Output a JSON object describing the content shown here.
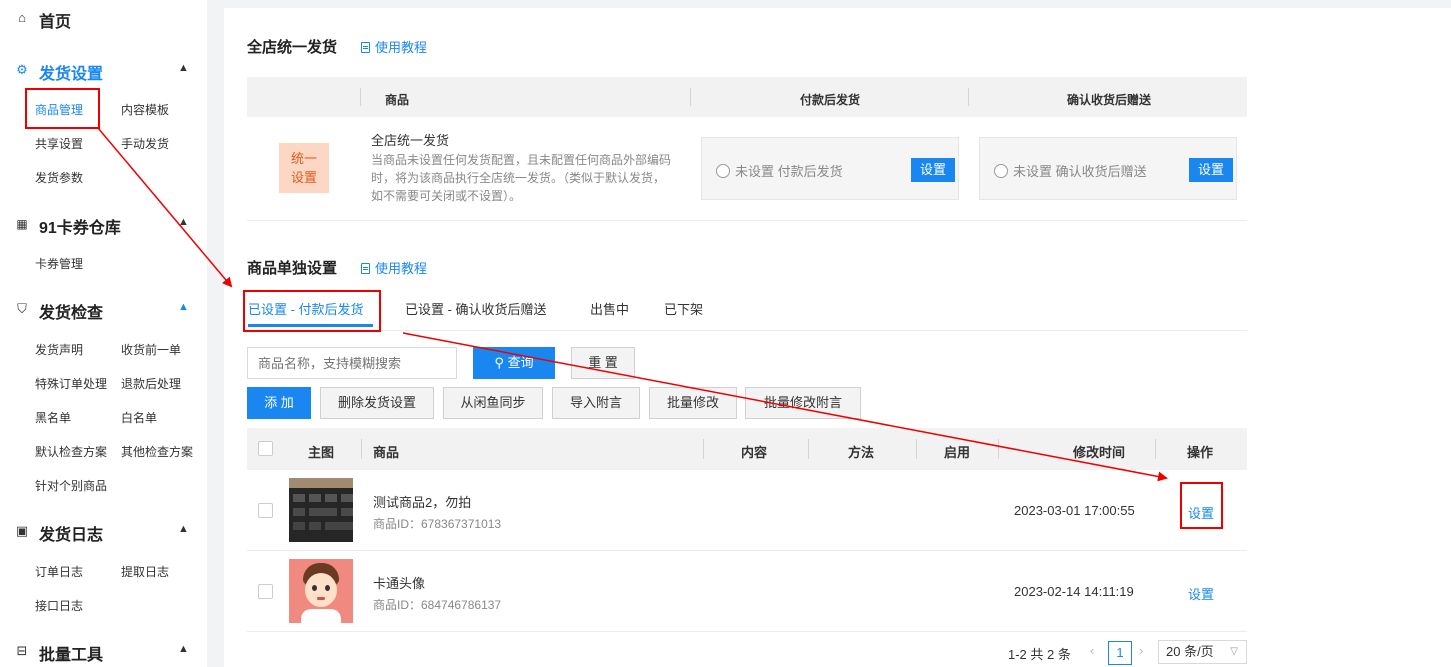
{
  "sidebar": {
    "home": "首页",
    "delivery_settings": {
      "title": "发货设置",
      "items": [
        "商品管理",
        "内容模板",
        "共享设置",
        "手动发货",
        "发货参数"
      ]
    },
    "coupon_store": {
      "title": "91卡券仓库",
      "items": [
        "卡券管理"
      ]
    },
    "delivery_check": {
      "title": "发货检查",
      "items": [
        "发货声明",
        "收货前一单",
        "特殊订单处理",
        "退款后处理",
        "黑名单",
        "白名单",
        "默认检查方案",
        "其他检查方案",
        "针对个别商品"
      ]
    },
    "delivery_log": {
      "title": "发货日志",
      "items": [
        "订单日志",
        "提取日志",
        "接口日志"
      ]
    },
    "batch_tools": {
      "title": "批量工具"
    }
  },
  "store": {
    "title": "全店统一发货",
    "tutorial": "使用教程",
    "headers": [
      "商品",
      "付款后发货",
      "确认收货后赠送"
    ],
    "badge": "统一设置",
    "name": "全店统一发货",
    "desc": "当商品未设置任何发货配置，且未配置任何商品外部编码时，将为该商品执行全店统一发货。（类似于默认发货，如不需要可关闭或不设置）。",
    "pay_option": "未设置 付款后发货",
    "confirm_option": "未设置 确认收货后赠送",
    "set_btn": "设置"
  },
  "single": {
    "title": "商品单独设置",
    "tutorial": "使用教程",
    "tabs": [
      "已设置 - 付款后发货",
      "已设置 - 确认收货后赠送",
      "出售中",
      "已下架"
    ],
    "search_placeholder": "商品名称，支持模糊搜索",
    "query": "查询",
    "reset": "重 置",
    "actions": [
      "添 加",
      "删除发货设置",
      "从闲鱼同步",
      "导入附言",
      "批量修改",
      "批量修改附言"
    ],
    "columns": [
      "主图",
      "商品",
      "内容",
      "方法",
      "启用",
      "修改时间",
      "操作"
    ],
    "rows": [
      {
        "name": "测试商品2，勿拍",
        "id": "商品ID：678367371013",
        "time": "2023-03-01 17:00:55",
        "op": "设置"
      },
      {
        "name": "卡通头像",
        "id": "商品ID：684746786137",
        "time": "2023-02-14 14:11:19",
        "op": "设置"
      }
    ],
    "pagination": {
      "summary": "1-2 共 2 条",
      "page": "1",
      "size": "20 条/页"
    }
  },
  "colors": {
    "accent": "#1a87f0",
    "badge_bg": "#fcd7c4",
    "badge_text": "#e05a1e",
    "annotation": "#e00000"
  }
}
